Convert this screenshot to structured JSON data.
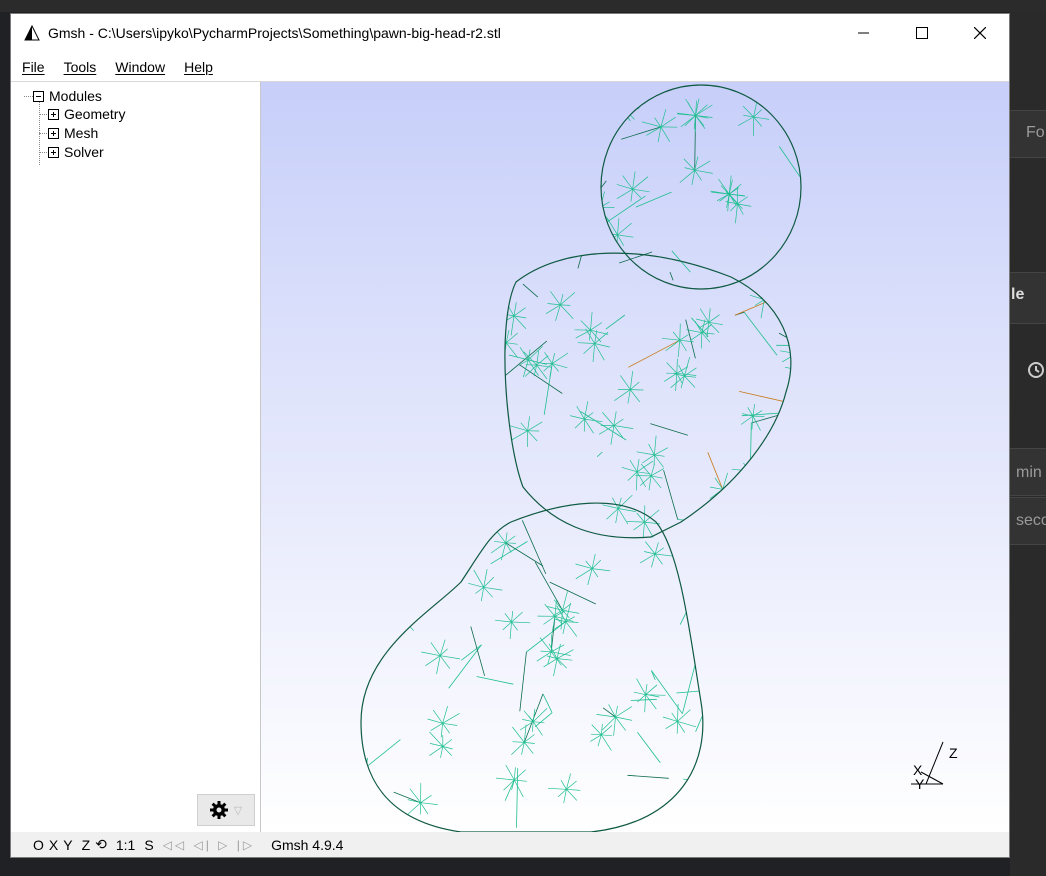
{
  "window": {
    "title": "Gmsh - C:\\Users\\ipyko\\PycharmProjects\\Something\\pawn-big-head-r2.stl",
    "controls": [
      "minimize",
      "maximize",
      "close"
    ]
  },
  "menu": [
    {
      "first": "F",
      "rest": "ile"
    },
    {
      "first": "T",
      "rest": "ools"
    },
    {
      "first": "W",
      "rest": "indow"
    },
    {
      "first": "H",
      "rest": "elp"
    }
  ],
  "tree": {
    "root": "Modules",
    "children": [
      "Geometry",
      "Mesh",
      "Solver"
    ]
  },
  "viewport": {
    "model": "pawn mesh wireframe",
    "mesh_color": "#1fbf8f",
    "inner_color": "#c87a1a",
    "axes": {
      "z": "Z",
      "x": "X",
      "y": "Y"
    }
  },
  "statusbar": {
    "o": "O",
    "x": "X",
    "y": "Y",
    "z": "Z",
    "rotate_icon": "rotate-icon",
    "scale": "1:1",
    "s": "S",
    "nav": "◁◁ ◁| ▷ |▷",
    "status": "Gmsh 4.9.4"
  },
  "background": {
    "right_labels": [
      "Fo",
      "le",
      "min",
      "seco"
    ]
  }
}
